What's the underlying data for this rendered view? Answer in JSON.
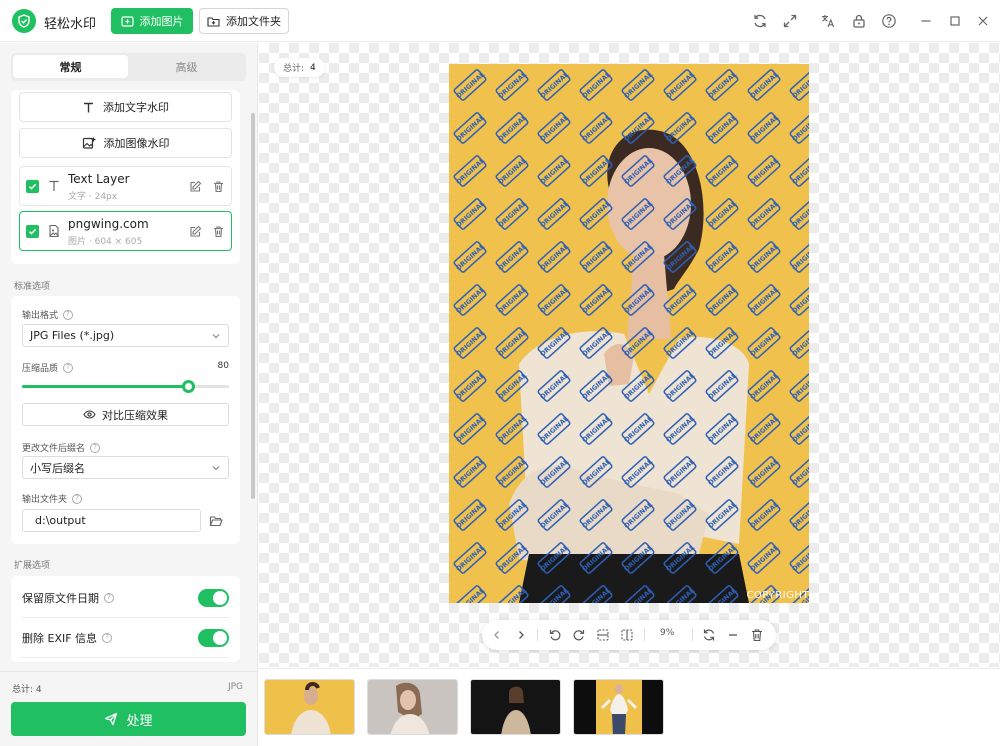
{
  "app": {
    "title": "轻松水印"
  },
  "header": {
    "add_image_label": "添加图片",
    "add_folder_label": "添加文件夹"
  },
  "sidebar": {
    "tabs": [
      {
        "label": "常规",
        "active": true
      },
      {
        "label": "高级",
        "active": false
      }
    ],
    "watermark_buttons": {
      "add_text": "添加文字水印",
      "add_image": "添加图像水印"
    },
    "layers": [
      {
        "name": "Text Layer",
        "type": "文字",
        "detail": "24px",
        "checked": true,
        "icon": "text-icon"
      },
      {
        "name": "pngwing.com",
        "type": "图片",
        "detail": "604 × 605",
        "checked": true,
        "icon": "image-file-icon"
      }
    ],
    "standard_options": {
      "section_label": "标准选项",
      "output_format_label": "输出格式",
      "output_format_value": "JPG Files (*.jpg)",
      "quality_label": "压缩品质",
      "quality_value": 80,
      "compare_label": "对比压缩效果",
      "suffix_label": "更改文件后缀名",
      "suffix_value": "小写后缀名",
      "output_folder_label": "输出文件夹",
      "output_folder_value": "d:\\output"
    },
    "extended_options": {
      "section_label": "扩展选项",
      "toggles": [
        {
          "label": "保留原文件日期",
          "on": true
        },
        {
          "label": "删除 EXIF 信息",
          "on": true
        }
      ]
    },
    "footer": {
      "total_label": "总计:",
      "total_value": "4",
      "format": "JPG",
      "process_label": "处理"
    }
  },
  "canvas": {
    "count_label": "总计:",
    "count_value": "4",
    "watermark_text": "ORIGINAL",
    "copyright_text": "COPYRIGHT",
    "zoom": "9%"
  },
  "thumbnails": [
    {
      "bg": "#efc04a",
      "name": "thumb-1"
    },
    {
      "bg": "#c9c4c0",
      "name": "thumb-2"
    },
    {
      "bg": "#141414",
      "name": "thumb-3"
    },
    {
      "bg": "#0d0d0d",
      "name": "thumb-4"
    }
  ],
  "colors": {
    "accent": "#1fbf62",
    "preview_bg": "#f0c24d",
    "watermark": "#2d5fb6"
  }
}
